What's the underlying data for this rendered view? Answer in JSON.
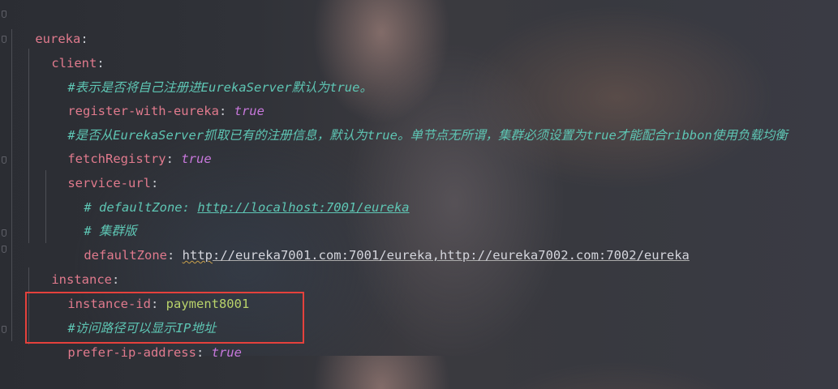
{
  "code": {
    "l1": {
      "key": "eureka",
      "colon": ":"
    },
    "l2": {
      "key": "client",
      "colon": ":"
    },
    "l3": {
      "comment": "#表示是否将自己注册进EurekaServer默认为true。"
    },
    "l4": {
      "key": "register-with-eureka",
      "colon": ": ",
      "value": "true"
    },
    "l5": {
      "comment": "#是否从EurekaServer抓取已有的注册信息，默认为true。单节点无所谓，集群必须设置为true才能配合ribbon使用负载均衡"
    },
    "l6": {
      "key": "fetchRegistry",
      "colon": ": ",
      "value": "true"
    },
    "l7": {
      "key": "service-url",
      "colon": ":"
    },
    "l8": {
      "comment_prefix": "# defaultZone: ",
      "comment_url": "http://localhost:7001/eureka"
    },
    "l9": {
      "comment": "# 集群版"
    },
    "l10": {
      "key": "defaultZone",
      "colon": ": ",
      "url_a": "http",
      "url_b": "://eureka7001.com:7001/eureka,http://eureka7002.com:7002/eureka"
    },
    "l11": {
      "key": "instance",
      "colon": ":"
    },
    "l12": {
      "key": "instance-id",
      "colon": ": ",
      "value": "payment8001"
    },
    "l13": {
      "comment": "#访问路径可以显示IP地址"
    },
    "l14": {
      "key": "prefer-ip-address",
      "colon": ": ",
      "value": "true"
    }
  },
  "colors": {
    "key": "#e07a8d",
    "bool_value": "#c878dc",
    "string_value": "#b8d26a",
    "comment": "#5ec6b4",
    "highlight_border": "#e5413c"
  }
}
